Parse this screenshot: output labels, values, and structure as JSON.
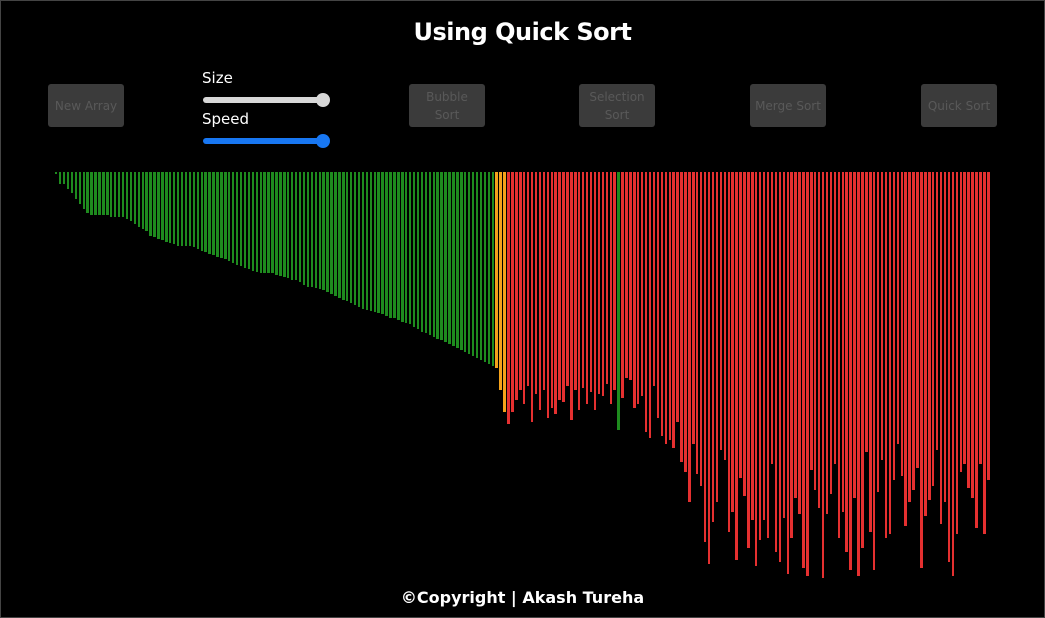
{
  "header": {
    "title": "Using Quick Sort"
  },
  "toolbar": {
    "new_array": "New Array",
    "size_label": "Size",
    "speed_label": "Speed",
    "bubble_sort": "Bubble Sort",
    "selection_sort": "Selection Sort",
    "merge_sort": "Merge Sort",
    "quick_sort": "Quick Sort"
  },
  "sliders": {
    "size": {
      "value": 1.0,
      "color": "#d7d7d7"
    },
    "speed": {
      "value": 1.0,
      "color": "#1877f2"
    }
  },
  "colors": {
    "sorted": "#1e8b1e",
    "pivot": "#f4a21b",
    "unsorted": "#e53030"
  },
  "array": {
    "values": [
      2,
      12,
      12,
      17,
      21,
      27,
      32,
      37,
      41,
      43,
      43,
      43,
      43,
      43,
      45,
      45,
      45,
      45,
      47,
      49,
      52,
      55,
      57,
      59,
      64,
      65,
      67,
      68,
      70,
      71,
      72,
      74,
      74,
      74,
      74,
      75,
      77,
      79,
      80,
      82,
      83,
      85,
      86,
      87,
      89,
      91,
      93,
      94,
      96,
      97,
      99,
      100,
      101,
      101,
      101,
      101,
      103,
      104,
      105,
      106,
      108,
      108,
      110,
      113,
      115,
      115,
      116,
      117,
      118,
      120,
      122,
      124,
      126,
      128,
      129,
      131,
      133,
      135,
      137,
      138,
      139,
      140,
      141,
      142,
      144,
      146,
      146,
      148,
      150,
      151,
      152,
      155,
      157,
      160,
      161,
      163,
      165,
      167,
      168,
      170,
      172,
      174,
      176,
      178,
      180,
      182,
      184,
      186,
      188,
      190,
      192,
      194,
      196,
      198,
      200,
      202,
      204,
      206,
      208,
      210,
      212,
      214,
      216,
      218,
      220,
      222,
      224,
      226,
      228,
      230,
      232,
      234,
      236,
      238,
      240,
      242
    ],
    "states_note": "first 112 sorted, then pivot, then unsorted region",
    "sorted_count": 112,
    "pivot_index": 112,
    "unsorted_values": [
      252,
      240,
      228,
      218,
      232,
      214,
      250,
      222,
      238,
      218,
      246,
      236,
      242,
      228,
      230,
      214,
      248,
      218,
      238,
      216,
      232,
      220,
      238,
      222,
      224,
      212,
      232,
      218,
      226,
      206,
      208,
      236,
      232,
      224,
      260,
      266,
      214,
      246,
      264,
      272,
      268,
      276,
      250,
      290,
      300,
      330,
      272,
      302,
      314,
      370,
      392,
      350,
      330,
      278,
      288,
      360,
      340,
      388,
      306,
      324,
      376,
      348,
      394,
      368,
      348,
      366,
      292,
      380,
      390,
      346,
      402,
      366,
      326,
      342,
      396,
      404,
      298,
      318,
      336,
      406,
      342,
      322,
      292,
      366,
      340,
      380,
      398,
      326,
      404,
      376,
      280,
      360,
      398,
      320,
      288,
      366,
      362,
      308,
      272,
      304,
      354,
      330,
      318,
      296,
      396,
      344,
      328,
      314,
      278,
      352,
      330,
      390,
      404,
      362,
      300,
      292,
      316,
      326,
      356,
      292,
      362,
      308
    ],
    "mid_sorted": [
      {
        "after_unsorted_index": 27,
        "value": 258
      }
    ]
  },
  "footer": {
    "text": "©Copyright | Akash Tureha"
  }
}
